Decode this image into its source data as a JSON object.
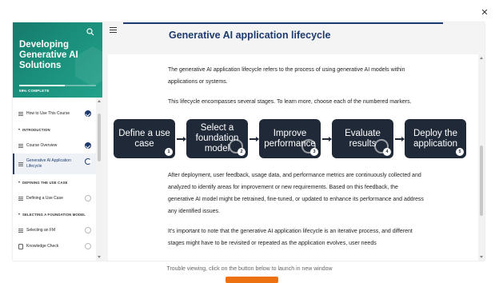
{
  "window": {
    "close_icon": "close-icon"
  },
  "sidebar": {
    "course_title": "Developing Generative AI Solutions",
    "progress_label": "59% COMPLETE",
    "progress_percent": 59,
    "search_icon": "search-icon",
    "items": [
      {
        "kind": "lesson",
        "label": "How to Use This Course",
        "status": "done"
      },
      {
        "kind": "section",
        "label": "INTRODUCTION"
      },
      {
        "kind": "lesson",
        "label": "Course Overview",
        "status": "done"
      },
      {
        "kind": "lesson",
        "label": "Generative AI Application Lifecycle",
        "status": "active",
        "current": true
      },
      {
        "kind": "section",
        "label": "DEFINING THE USE CASE"
      },
      {
        "kind": "lesson",
        "label": "Defining a Use Case",
        "status": "todo"
      },
      {
        "kind": "section",
        "label": "SELECTING A FOUNDATION MODEL"
      },
      {
        "kind": "lesson",
        "label": "Selecting an FM",
        "status": "todo"
      },
      {
        "kind": "quiz",
        "label": "Knowledge Check",
        "status": "todo"
      }
    ]
  },
  "main": {
    "title": "Generative AI application lifecycle",
    "intro_1": "The generative AI application lifecycle refers to the process of using generative AI models within applications or systems.",
    "intro_2": "This lifecycle encompasses several stages. To learn more, choose each of the numbered markers.",
    "steps": [
      {
        "label": "Define a use case",
        "number": "1"
      },
      {
        "label": "Select a foundation model",
        "number": "2"
      },
      {
        "label": "Improve performance",
        "number": "3"
      },
      {
        "label": "Evaluate results",
        "number": "4"
      },
      {
        "label": "Deploy the application",
        "number": "5"
      }
    ],
    "after_1": "After deployment, user feedback, usage data, and performance metrics are continuously collected and analyzed to identify areas for improvement or new requirements. Based on this feedback, the generative AI model might be retrained, fine-tuned, or updated to enhance its performance and address any identified issues.",
    "after_2": "It's important to note that the generative AI application lifecycle is an iterative process, and different stages might have to be revisited or repeated as the application evolves, user needs"
  },
  "footer": {
    "trouble_text": "Trouble viewing, click on the button below to launch in new window"
  }
}
